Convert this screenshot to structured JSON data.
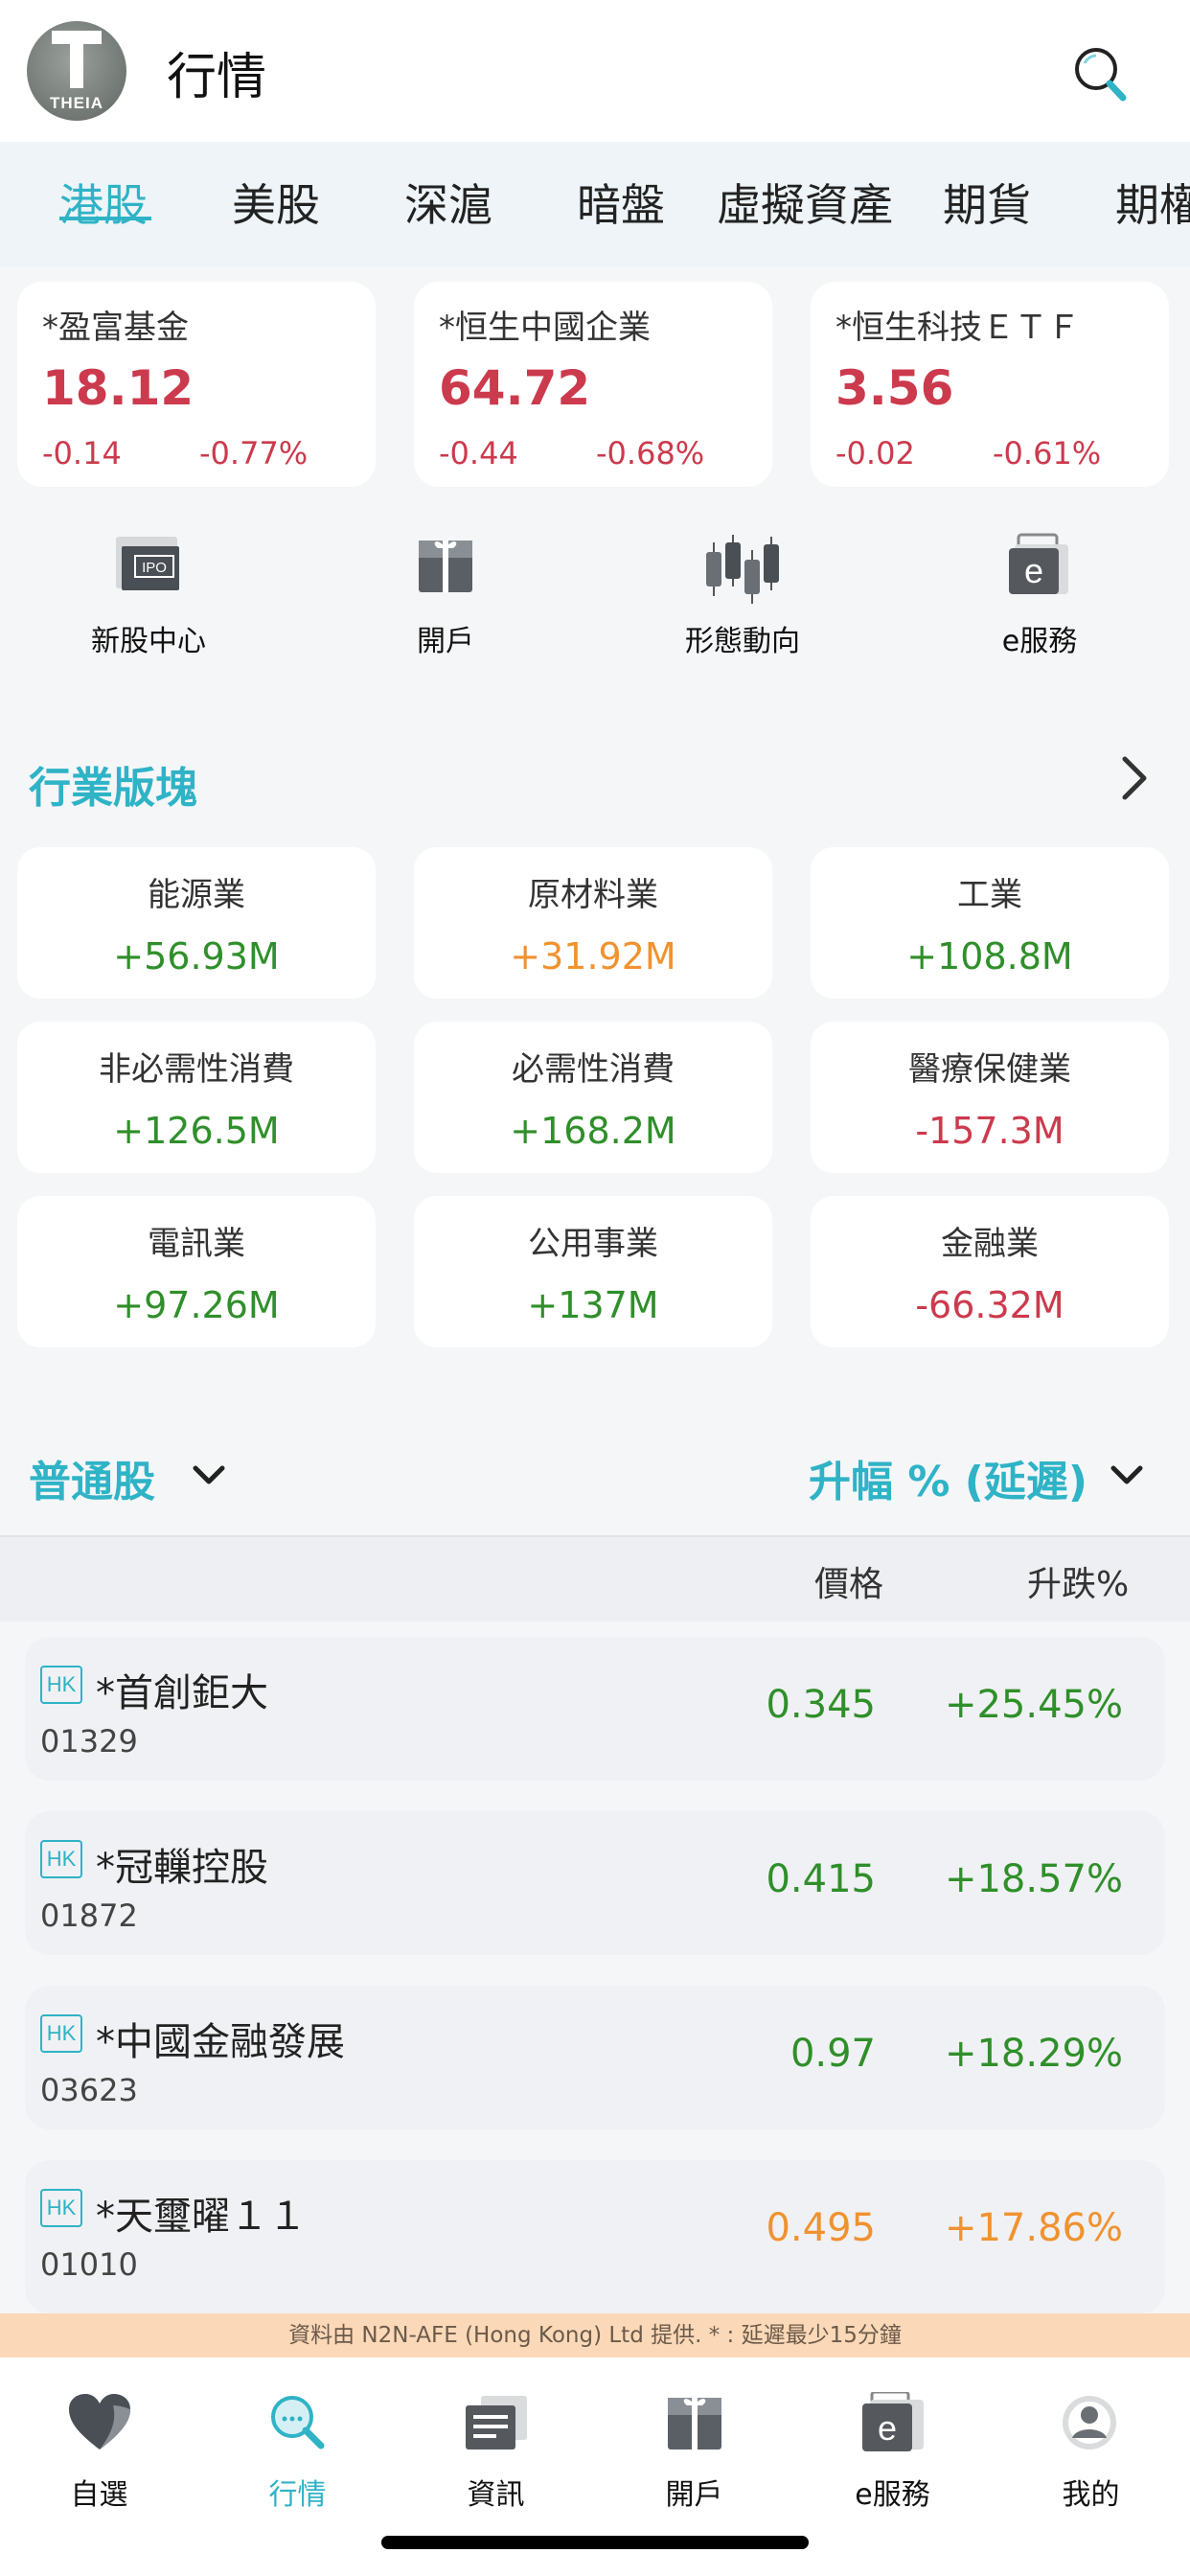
{
  "header": {
    "logo_text": "THEIA",
    "title": "行情"
  },
  "tabs": [
    {
      "label": "港股",
      "active": true
    },
    {
      "label": "美股"
    },
    {
      "label": "深滬"
    },
    {
      "label": "暗盤"
    },
    {
      "label": "虛擬資產"
    },
    {
      "label": "期貨"
    },
    {
      "label": "期權"
    }
  ],
  "indices": [
    {
      "name": "*盈富基金",
      "price": "18.12",
      "change": "-0.14",
      "pct": "-0.77%"
    },
    {
      "name": "*恒生中國企業",
      "price": "64.72",
      "change": "-0.44",
      "pct": "-0.68%"
    },
    {
      "name": "*恒生科技ＥＴＦ",
      "price": "3.56",
      "change": "-0.02",
      "pct": "-0.61%"
    }
  ],
  "shortcuts": [
    {
      "label": "新股中心",
      "icon": "ipo-icon"
    },
    {
      "label": "開戶",
      "icon": "gift-icon"
    },
    {
      "label": "形態動向",
      "icon": "candlestick-icon"
    },
    {
      "label": "e服務",
      "icon": "e-service-icon"
    }
  ],
  "sectors_section": {
    "title": "行業版塊"
  },
  "sectors": [
    {
      "name": "能源業",
      "value": "+56.93M",
      "color": "green"
    },
    {
      "name": "原材料業",
      "value": "+31.92M",
      "color": "orange"
    },
    {
      "name": "工業",
      "value": "+108.8M",
      "color": "green"
    },
    {
      "name": "非必需性消費",
      "value": "+126.5M",
      "color": "green"
    },
    {
      "name": "必需性消費",
      "value": "+168.2M",
      "color": "green"
    },
    {
      "name": "醫療保健業",
      "value": "-157.3M",
      "color": "red"
    },
    {
      "name": "電訊業",
      "value": "+97.26M",
      "color": "green"
    },
    {
      "name": "公用事業",
      "value": "+137M",
      "color": "green"
    },
    {
      "name": "金融業",
      "value": "-66.32M",
      "color": "red"
    }
  ],
  "stock_filter": {
    "type_label": "普通股",
    "sort_label": "升幅 % (延遲)"
  },
  "list_header": {
    "price": "價格",
    "pct": "升跌%"
  },
  "stocks": [
    {
      "badge": "HK",
      "name": "*首創鉅大",
      "code": "01329",
      "price": "0.345",
      "pct": "+25.45%",
      "color": "green"
    },
    {
      "badge": "HK",
      "name": "*冠轈控股",
      "code": "01872",
      "price": "0.415",
      "pct": "+18.57%",
      "color": "green"
    },
    {
      "badge": "HK",
      "name": "*中國金融發展",
      "code": "03623",
      "price": "0.97",
      "pct": "+18.29%",
      "color": "green"
    },
    {
      "badge": "HK",
      "name": "*天璽曜１１",
      "code": "01010",
      "price": "0.495",
      "pct": "+17.86%",
      "color": "orange"
    }
  ],
  "disclaimer": "資料由 N2N-AFE (Hong Kong) Ltd 提供. * : 延遲最少15分鐘",
  "bottom_nav": [
    {
      "label": "自選",
      "icon": "heart-icon"
    },
    {
      "label": "行情",
      "icon": "market-search-icon",
      "active": true
    },
    {
      "label": "資訊",
      "icon": "news-icon"
    },
    {
      "label": "開戶",
      "icon": "gift-icon"
    },
    {
      "label": "e服務",
      "icon": "e-service-icon"
    },
    {
      "label": "我的",
      "icon": "profile-icon"
    }
  ],
  "colors": {
    "accent": "#2fb3c6",
    "up": "#2f8f2a",
    "flat": "#f0922f",
    "down": "#cc3a4d"
  }
}
